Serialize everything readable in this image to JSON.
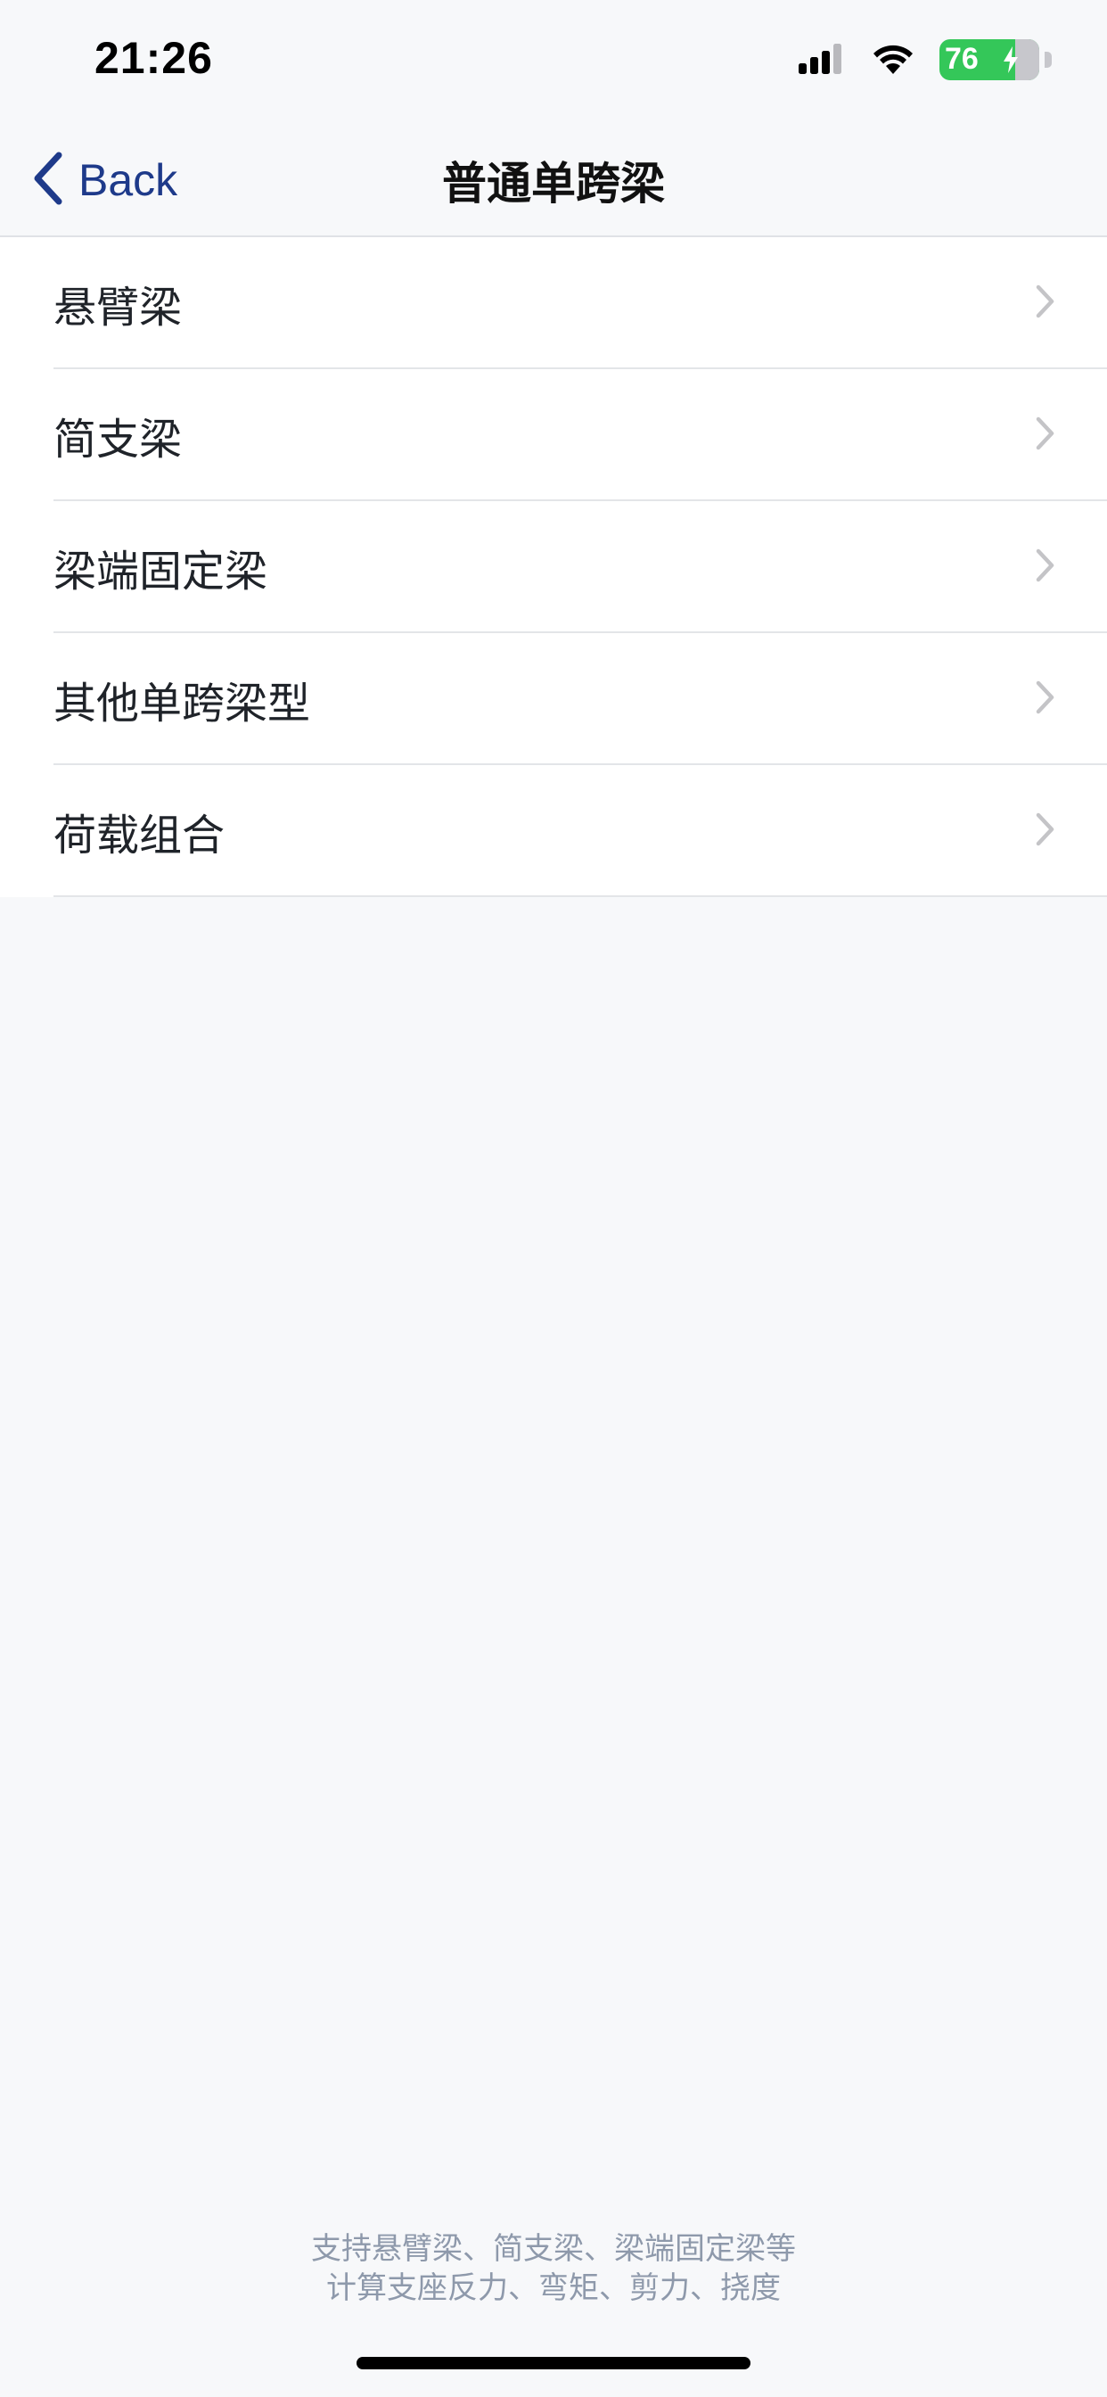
{
  "status_bar": {
    "time": "21:26",
    "battery_level": "76",
    "icons": [
      "signal-icon",
      "wifi-icon",
      "battery-icon"
    ],
    "battery_color": "#34c759"
  },
  "nav": {
    "back_label": "Back",
    "title": "普通单跨梁",
    "accent_color": "#1e3a8a"
  },
  "menu": {
    "items": [
      {
        "label": "悬臂梁"
      },
      {
        "label": "简支梁"
      },
      {
        "label": "梁端固定梁"
      },
      {
        "label": "其他单跨梁型"
      },
      {
        "label": "荷载组合"
      }
    ]
  },
  "footer": {
    "line1": "支持悬臂梁、简支梁、梁端固定梁等",
    "line2": "计算支座反力、弯矩、剪力、挠度"
  }
}
